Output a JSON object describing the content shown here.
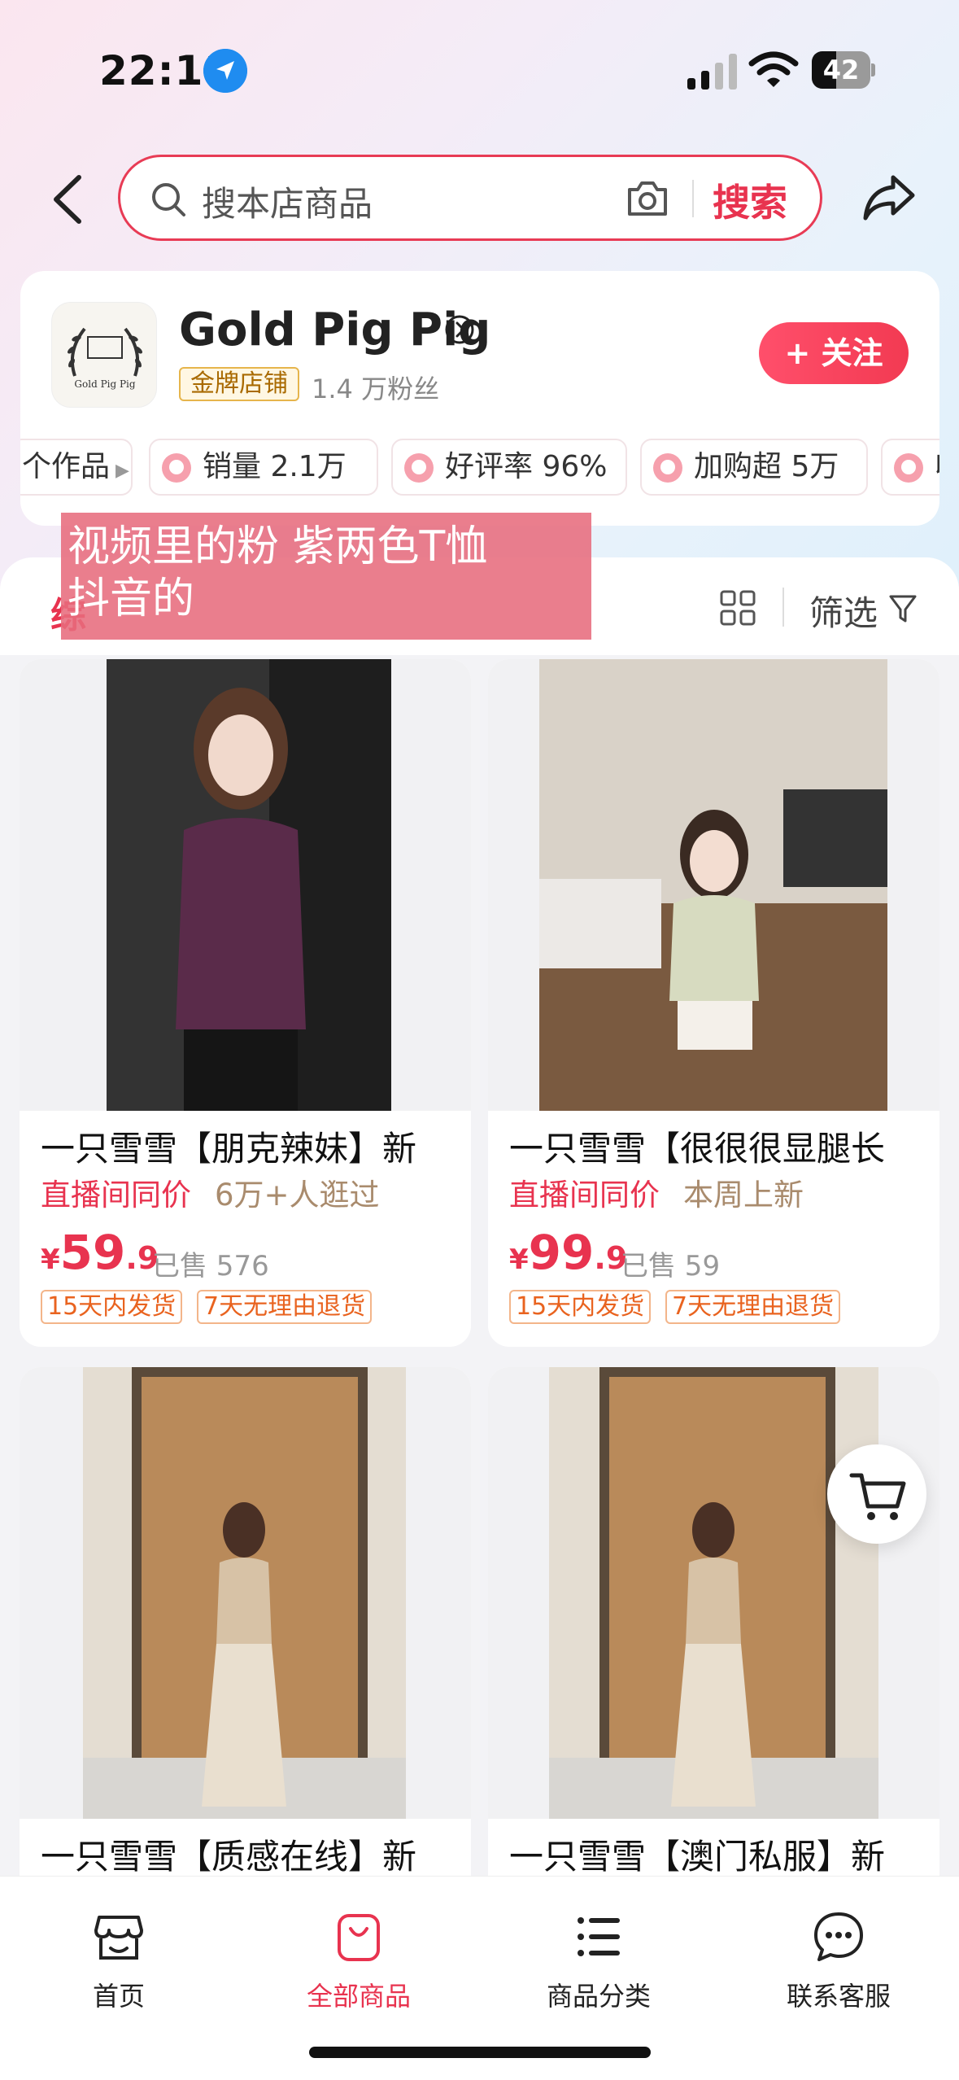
{
  "status_bar": {
    "time": "22:11",
    "battery": "42",
    "battery_level": 0.42
  },
  "search": {
    "placeholder": "搜本店商品",
    "button": "搜索"
  },
  "store": {
    "name": "Gold Pig Pig",
    "logo_text": "Gold Pig Pig",
    "badge": "金牌店铺",
    "fans": "1.4 万粉丝",
    "follow": "+ 关注",
    "stats": [
      "个作品",
      "销量 2.1万",
      "好评率 96%",
      "加购超 5万",
      "收"
    ]
  },
  "overlay_caption": {
    "line1": "视频里的粉 紫两色T恤",
    "line2": "抖音的"
  },
  "toolbar": {
    "tab_partial": "综",
    "filter": "筛选"
  },
  "products": [
    {
      "title": "一只雪雪【朋克辣妹】新",
      "live": "直播间同价",
      "extra": "6万+人逛过",
      "yen": "¥",
      "price_int": "59",
      "price_dec": ".9",
      "sold": "已售 576",
      "tags": [
        "15天内发货",
        "7天无理由退货"
      ],
      "photo_color": "#5a2b4a"
    },
    {
      "title": "一只雪雪【很很很显腿长",
      "live": "直播间同价",
      "extra": "本周上新",
      "yen": "¥",
      "price_int": "99",
      "price_dec": ".9",
      "sold": "已售 59",
      "tags": [
        "15天内发货",
        "7天无理由退货"
      ],
      "photo_color": "#d7dbc0"
    },
    {
      "title": "一只雪雪【质感在线】新",
      "photo_color": "#d7c2a6"
    },
    {
      "title": "一只雪雪【澳门私服】新",
      "photo_color": "#d7c2a6"
    }
  ],
  "bottom_nav": [
    {
      "label": "首页",
      "icon": "store-icon",
      "active": false
    },
    {
      "label": "全部商品",
      "icon": "shopping-bag-icon",
      "active": true
    },
    {
      "label": "商品分类",
      "icon": "list-icon",
      "active": false
    },
    {
      "label": "联系客服",
      "icon": "chat-icon",
      "active": false
    }
  ],
  "colors": {
    "accent": "#e8334f",
    "gold": "#e6b54c",
    "tag": "#e9631f"
  }
}
